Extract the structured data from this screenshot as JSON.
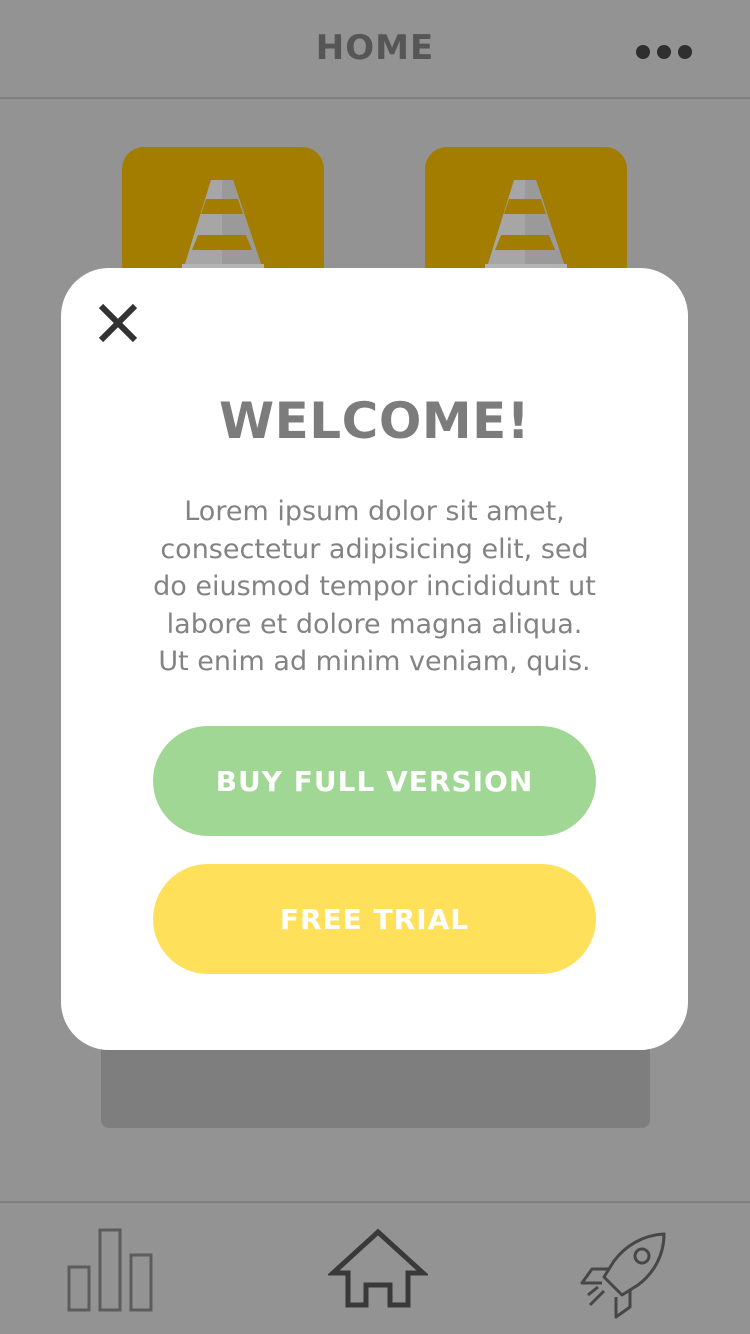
{
  "header": {
    "title": "HOME",
    "more_icon": "more-horizontal-icon"
  },
  "content": {
    "tiles": [
      {
        "icon": "traffic-cone-icon",
        "color": "#a27d00"
      },
      {
        "icon": "traffic-cone-icon",
        "color": "#a27d00"
      }
    ]
  },
  "modal": {
    "close_icon": "close-icon",
    "title": "WELCOME!",
    "body_lines": [
      "Lorem ipsum dolor sit amet,",
      "consectetur adipisicing elit, sed",
      "do eiusmod tempor incididunt ut",
      "labore et dolore magna aliqua.",
      "Ut enim ad minim veniam, quis."
    ],
    "primary_button": {
      "label": "BUY FULL VERSION",
      "color": "#a0d794"
    },
    "secondary_button": {
      "label": "FREE TRIAL",
      "color": "#ffe05b"
    }
  },
  "tabbar": {
    "items": [
      {
        "icon": "bar-chart-icon"
      },
      {
        "icon": "home-icon"
      },
      {
        "icon": "rocket-icon"
      }
    ]
  }
}
